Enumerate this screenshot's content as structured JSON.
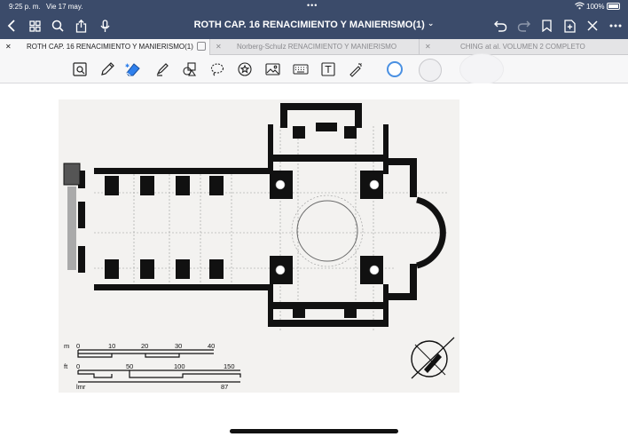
{
  "status_bar": {
    "time": "9:25 p. m.",
    "date": "Vie 17 may.",
    "dots": "•••",
    "battery": "100%"
  },
  "nav": {
    "title": "ROTH CAP. 16  RENACIMIENTO Y MANIERISMO(1)",
    "title_chevron": "⌄",
    "left_icons": [
      "back-icon",
      "grid-icon",
      "search-icon",
      "share-icon",
      "microphone-icon"
    ],
    "right_icons": [
      "undo-icon",
      "redo-icon",
      "bookmark-icon",
      "add-page-icon",
      "close-icon",
      "more-icon"
    ]
  },
  "tabs": [
    {
      "label": "ROTH CAP. 16  RENACIMIENTO Y MANIERISMO(1)",
      "active": true
    },
    {
      "label": "Norberg-Schulz RENACIMIENTO Y MANIERISMO",
      "active": false
    },
    {
      "label": "CHING at al. VOLUMEN  2 COMPLETO",
      "active": false
    }
  ],
  "tools": [
    "zoom-lasso-icon",
    "pen-icon",
    "eraser-icon",
    "highlighter-icon",
    "shapes-icon",
    "lasso-icon",
    "sticker-icon",
    "image-icon",
    "keyboard-icon",
    "text-icon",
    "laser-icon"
  ],
  "colors": {
    "nav_bg": "#3b4b6a",
    "accent": "#2f80ed",
    "tab_bg": "#e4e4e6"
  },
  "plan": {
    "scale_m": {
      "unit": "m",
      "ticks": [
        "0",
        "10",
        "20",
        "30",
        "40"
      ]
    },
    "scale_ft": {
      "unit": "ft",
      "ticks": [
        "0",
        "50",
        "100",
        "150"
      ]
    },
    "scale_lmr": {
      "unit": "lmr",
      "end": "87"
    }
  }
}
